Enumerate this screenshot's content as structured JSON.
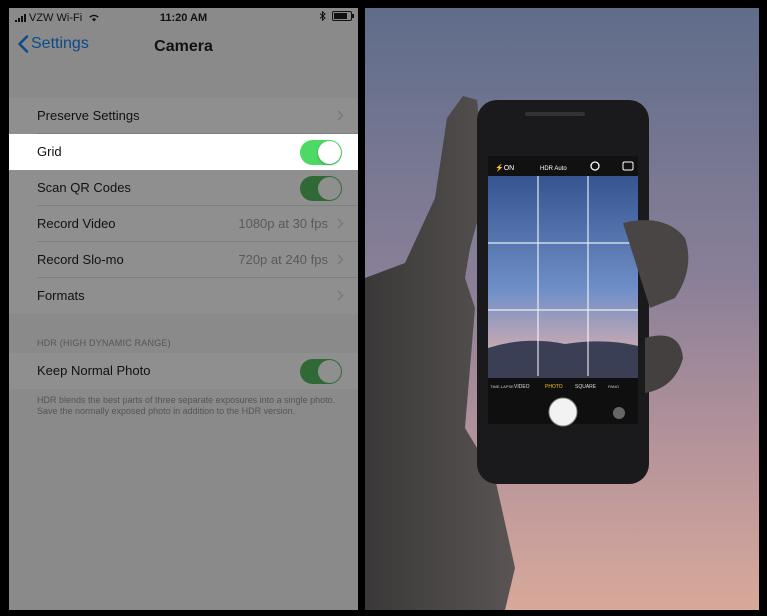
{
  "status": {
    "carrier": "VZW Wi-Fi",
    "time": "11:20 AM"
  },
  "nav": {
    "back_label": "Settings",
    "title": "Camera"
  },
  "rows": [
    {
      "label": "Preserve Settings",
      "value": ""
    },
    {
      "label": "Grid",
      "toggle": "on"
    },
    {
      "label": "Scan QR Codes",
      "toggle": "on"
    },
    {
      "label": "Record Video",
      "value": "1080p at 30 fps"
    },
    {
      "label": "Record Slo-mo",
      "value": "720p at 240 fps"
    },
    {
      "label": "Formats",
      "value": ""
    }
  ],
  "hdr": {
    "header": "HDR (HIGH DYNAMIC RANGE)",
    "row_label": "Keep Normal Photo",
    "footnote": "HDR blends the best parts of three separate exposures into a single photo. Save the normally exposed photo in addition to the HDR version."
  },
  "camera_ui": {
    "flash": "⚡ON",
    "hdr": "HDR Auto",
    "modes": [
      "TIME-LAPSE",
      "VIDEO",
      "PHOTO",
      "SQUARE",
      "PANO"
    ],
    "active_mode": "PHOTO"
  },
  "colors": {
    "toggle_on": "#4cd964",
    "back_link": "#0b4a8a",
    "mode_active": "#f5c518"
  }
}
